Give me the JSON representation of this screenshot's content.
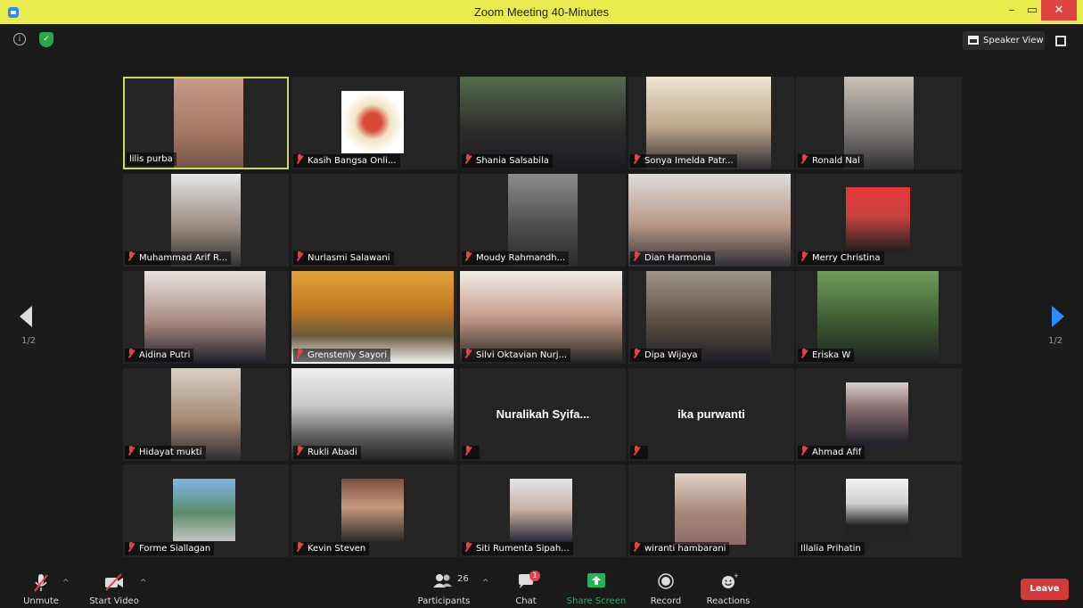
{
  "window": {
    "title": "Zoom Meeting 40-Minutes",
    "min": "–",
    "max": "▭",
    "close": "✕"
  },
  "topbar": {
    "speaker_view": "Speaker View"
  },
  "pager": {
    "left": "1/2",
    "right": "1/2"
  },
  "tiles": [
    {
      "name": "lilis purba",
      "muted": false,
      "active": true,
      "video": true
    },
    {
      "name": "Kasih Bangsa Onli...",
      "muted": true,
      "video": true
    },
    {
      "name": "Shania Salsabila",
      "muted": true,
      "video": true
    },
    {
      "name": "Sonya Imelda Patr...",
      "muted": true,
      "video": true
    },
    {
      "name": "Ronald Nal",
      "muted": true,
      "video": true
    },
    {
      "name": "Muhammad Arif R...",
      "muted": true,
      "video": true
    },
    {
      "name": "Nurlasmi Salawani",
      "muted": true,
      "video": false
    },
    {
      "name": "Moudy Rahmandh...",
      "muted": true,
      "video": true
    },
    {
      "name": "Dian Harmonia",
      "muted": true,
      "video": true
    },
    {
      "name": "Merry Christina",
      "muted": true,
      "video": true
    },
    {
      "name": "Aidina Putri",
      "muted": true,
      "video": true
    },
    {
      "name": "Grenstenly Sayori",
      "muted": true,
      "video": true
    },
    {
      "name": "Silvi Oktavian Nurj...",
      "muted": true,
      "video": true
    },
    {
      "name": "Dipa Wijaya",
      "muted": true,
      "video": true
    },
    {
      "name": "Eriska W",
      "muted": true,
      "video": true
    },
    {
      "name": "Hidayat mukti",
      "muted": true,
      "video": true
    },
    {
      "name": "Rukli Abadi",
      "muted": true,
      "video": true
    },
    {
      "name": "",
      "center_name": "Nuralikah  Syifa...",
      "muted": true,
      "video": false
    },
    {
      "name": "",
      "center_name": "ika purwanti",
      "muted": true,
      "video": false
    },
    {
      "name": "Ahmad Afif",
      "muted": true,
      "video": true
    },
    {
      "name": "Forme Siallagan",
      "muted": true,
      "video": true
    },
    {
      "name": "Kevin Steven",
      "muted": true,
      "video": true
    },
    {
      "name": "Siti Rumenta Sipah...",
      "muted": true,
      "video": true
    },
    {
      "name": "wiranti hambarani",
      "muted": true,
      "video": true
    },
    {
      "name": "Illalia Prihatin",
      "muted": false,
      "video": true
    }
  ],
  "toolbar": {
    "unmute": "Unmute",
    "start_video": "Start Video",
    "participants": "Participants",
    "participant_count": "26",
    "chat": "Chat",
    "chat_badge": "1",
    "share_screen": "Share Screen",
    "record": "Record",
    "reactions": "Reactions",
    "leave": "Leave"
  },
  "colors": {
    "titlebar": "#eaeb4e",
    "active_border": "#c8d964",
    "muted_icon": "#e0444a",
    "share": "#23b35a",
    "leave": "#d23a3a",
    "nav_right": "#2d8cff"
  }
}
